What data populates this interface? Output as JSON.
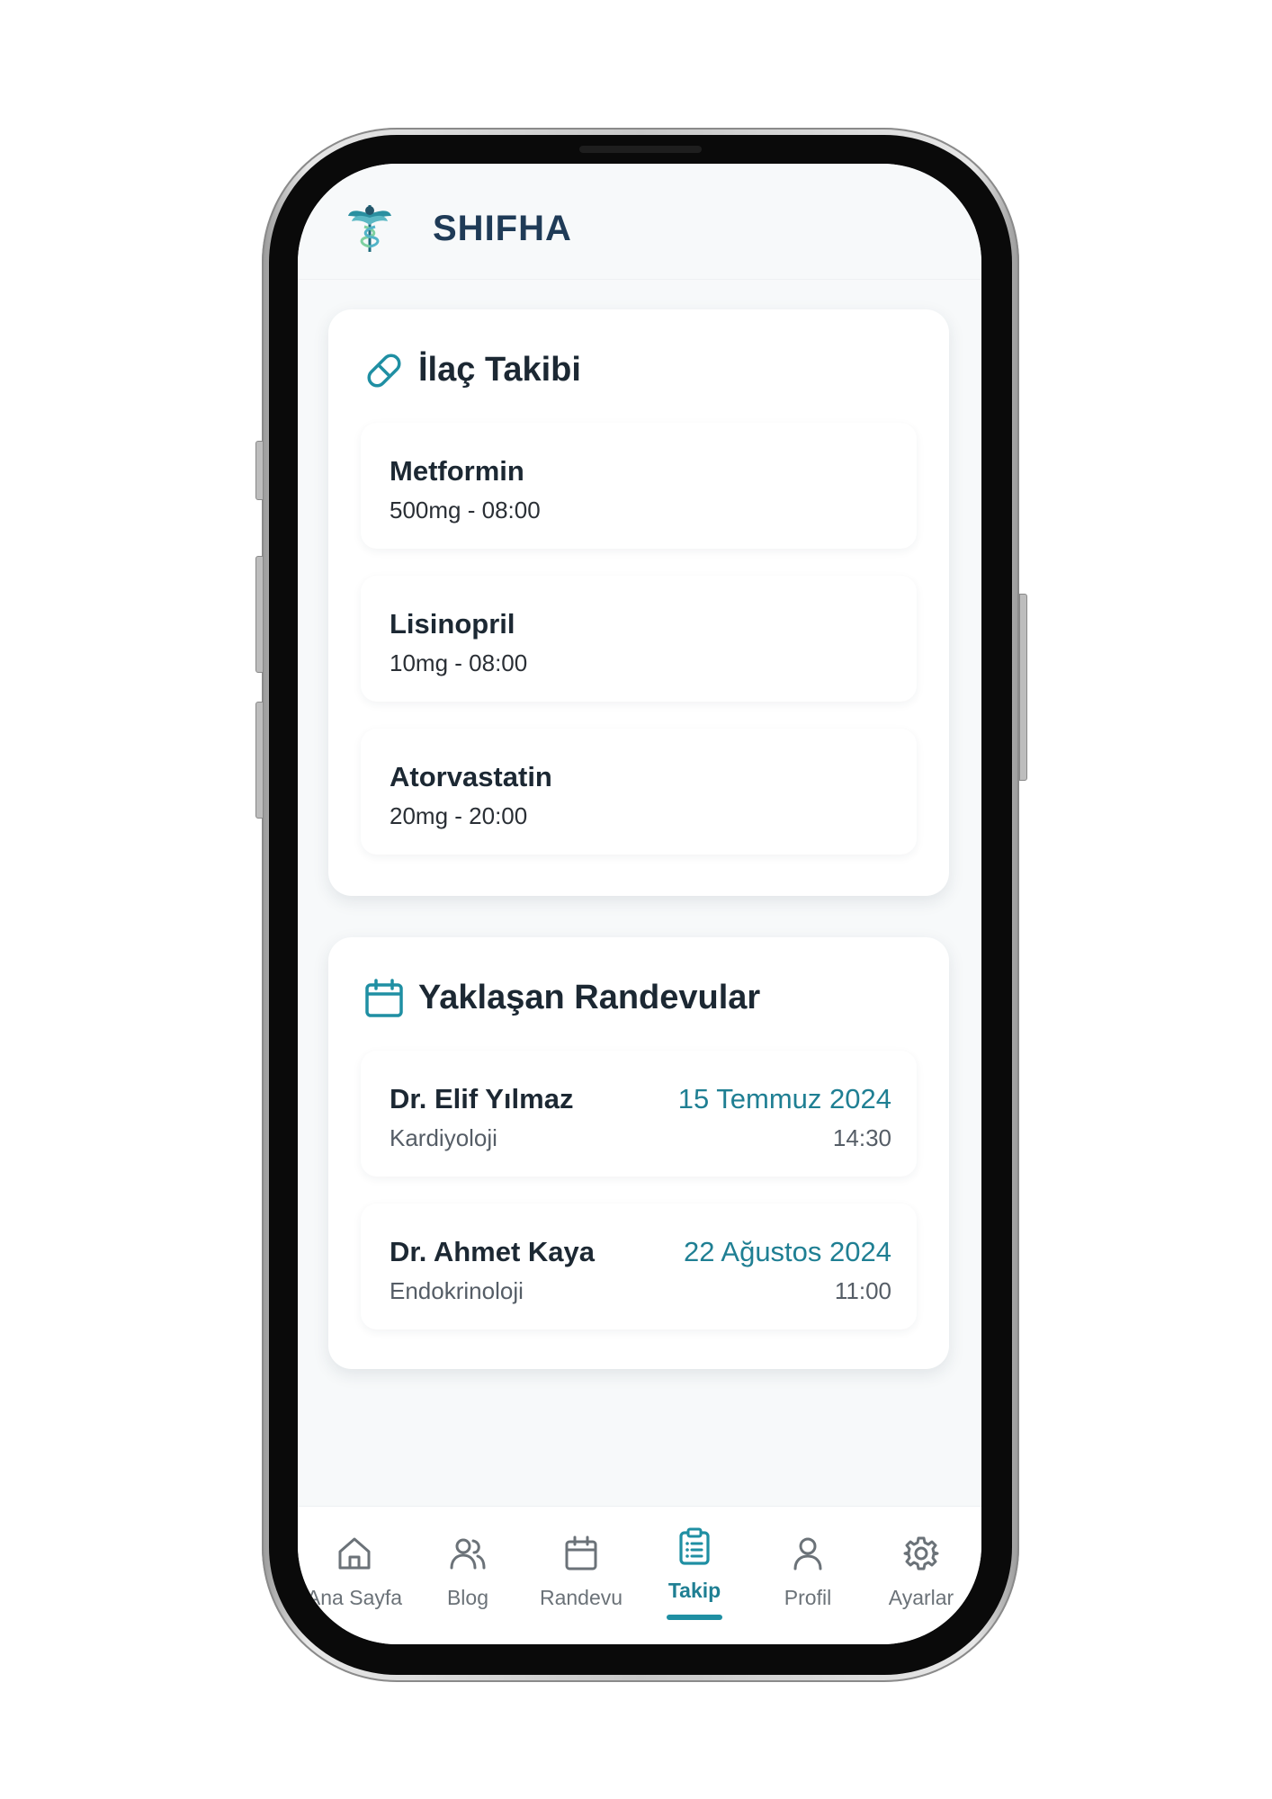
{
  "app": {
    "brand": "SHIFHA",
    "logo_icon": "caduceus-icon",
    "accent": "#1f8fa3"
  },
  "medications": {
    "title": "İlaç Takibi",
    "icon": "pill-icon",
    "items": [
      {
        "name": "Metformin",
        "detail": "500mg - 08:00"
      },
      {
        "name": "Lisinopril",
        "detail": "10mg - 08:00"
      },
      {
        "name": "Atorvastatin",
        "detail": "20mg - 20:00"
      }
    ]
  },
  "appointments": {
    "title": "Yaklaşan Randevular",
    "icon": "calendar-icon",
    "items": [
      {
        "doctor": "Dr. Elif Yılmaz",
        "department": "Kardiyoloji",
        "date": "15 Temmuz 2024",
        "time": "14:30"
      },
      {
        "doctor": "Dr. Ahmet Kaya",
        "department": "Endokrinoloji",
        "date": "22 Ağustos 2024",
        "time": "11:00"
      }
    ]
  },
  "nav": {
    "active": "Takip",
    "items": [
      {
        "label": "Ana Sayfa",
        "icon": "home-icon"
      },
      {
        "label": "Blog",
        "icon": "users-icon"
      },
      {
        "label": "Randevu",
        "icon": "calendar-icon"
      },
      {
        "label": "Takip",
        "icon": "clipboard-icon"
      },
      {
        "label": "Profil",
        "icon": "user-icon"
      },
      {
        "label": "Ayarlar",
        "icon": "gear-icon"
      }
    ]
  }
}
